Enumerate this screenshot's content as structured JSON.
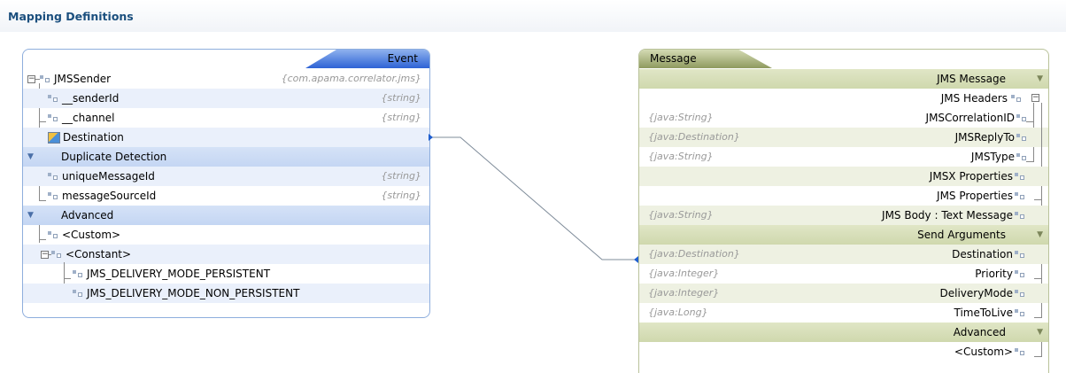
{
  "header": {
    "title": "Mapping Definitions"
  },
  "event_panel": {
    "tab_label": "Event",
    "root": {
      "name": "JMSSender",
      "type": "{com.apama.correlator.jms}"
    },
    "fields": [
      {
        "name": "__senderId",
        "type": "{string}"
      },
      {
        "name": "__channel",
        "type": "{string}"
      },
      {
        "name": "Destination",
        "type": ""
      }
    ],
    "duplicate_detection": {
      "label": "Duplicate Detection",
      "fields": [
        {
          "name": "uniqueMessageId",
          "type": "{string}"
        },
        {
          "name": "messageSourceId",
          "type": "{string}"
        }
      ]
    },
    "advanced": {
      "label": "Advanced",
      "custom": "<Custom>",
      "constant": "<Constant>",
      "constants": [
        "JMS_DELIVERY_MODE_PERSISTENT",
        "JMS_DELIVERY_MODE_NON_PERSISTENT"
      ]
    }
  },
  "message_panel": {
    "tab_label": "Message",
    "jms_message": {
      "label": "JMS Message",
      "headers_label": "JMS Headers",
      "headers": [
        {
          "type": "{java:String}",
          "name": "JMSCorrelationID"
        },
        {
          "type": "{java:Destination}",
          "name": "JMSReplyTo"
        },
        {
          "type": "{java:String}",
          "name": "JMSType"
        }
      ],
      "jmsx_properties": "JMSX Properties",
      "jms_properties": "JMS Properties",
      "body": {
        "type": "{java:String}",
        "name": "JMS Body : Text Message"
      }
    },
    "send_arguments": {
      "label": "Send Arguments",
      "items": [
        {
          "type": "{java:Destination}",
          "name": "Destination"
        },
        {
          "type": "{java:Integer}",
          "name": "Priority"
        },
        {
          "type": "{java:Integer}",
          "name": "DeliveryMode"
        },
        {
          "type": "{java:Long}",
          "name": "TimeToLive"
        }
      ]
    },
    "advanced": {
      "label": "Advanced",
      "custom": "<Custom>"
    }
  },
  "colors": {
    "event_accent": "#2e63d5",
    "message_accent": "#8f9a5f",
    "title": "#1b4f7e",
    "connector": "#7f8c9a"
  }
}
